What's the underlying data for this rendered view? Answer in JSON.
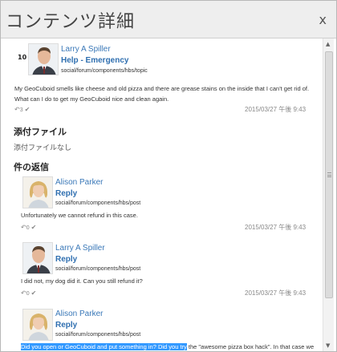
{
  "dialog": {
    "title": "コンテンツ詳細",
    "close_label": "x"
  },
  "topic": {
    "count": "10",
    "author": "Larry A Spiller",
    "subject": "Help - Emergency",
    "path": "social/forum/components/hbs/topic",
    "body_line1": "My GeoCuboid smells like cheese and old pizza and there are grease stains on the inside that I can't get rid of.",
    "body_line2": "What can I do to get my GeoCuboid nice and clean again.",
    "replies_count": "3",
    "date": "2015/03/27 午後 9:43"
  },
  "attachments": {
    "heading": "添付ファイル",
    "empty_text": "添付ファイルなし"
  },
  "replies": {
    "heading": "件の返信",
    "items": [
      {
        "author": "Alison Parker",
        "subject": "Reply",
        "path": "social/forum/components/hbs/post",
        "body": "Unfortunately we cannot refund in this case.",
        "count": "0",
        "date": "2015/03/27 午後 9:43"
      },
      {
        "author": "Larry A Spiller",
        "subject": "Reply",
        "path": "social/forum/components/hbs/post",
        "body": "I did not, my dog did it. Can you still refund it?",
        "count": "0",
        "date": "2015/03/27 午後 9:43"
      },
      {
        "author": "Alison Parker",
        "subject": "Reply",
        "path": "social/forum/components/hbs/post",
        "body_selected": "Did you open or GeoCuboid and put something in? Did you try",
        "body_rest": " the \"awesome pizza box hack\". In that case we"
      }
    ]
  },
  "icons": {
    "reply": "reply-icon",
    "check": "check-icon",
    "scroll_up": "scroll-up-arrow-icon",
    "scroll_down": "scroll-down-arrow-icon"
  },
  "colors": {
    "link": "#2f6fb0",
    "titlebar": "#eeeeee",
    "selection": "#3399ff"
  }
}
